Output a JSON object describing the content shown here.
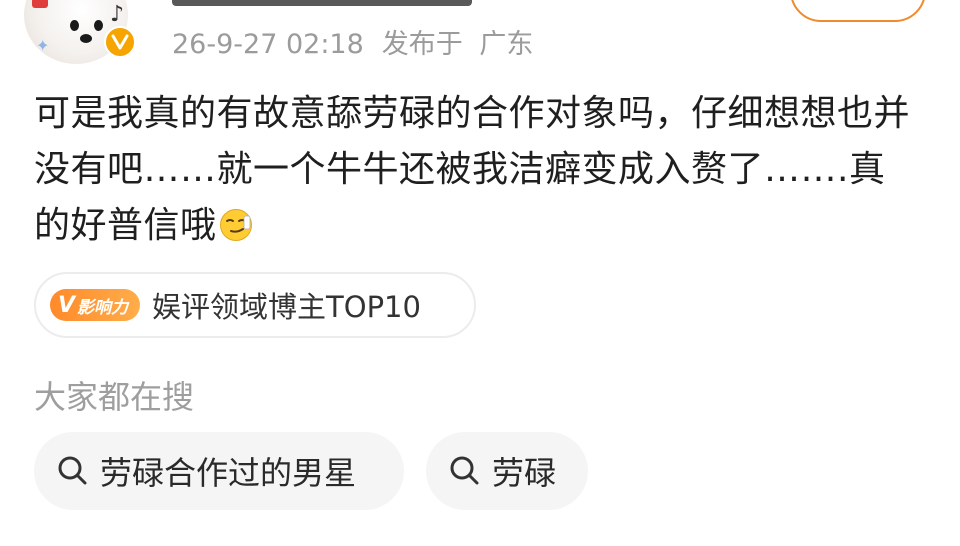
{
  "post": {
    "timestamp": "26-9-27 02:18",
    "location_prefix": "发布于",
    "location": "广东",
    "text": "可是我真的有故意舔劳碌的合作对象吗，仔细想想也并没有吧……就一个牛牛还被我洁癖变成入赘了…….真的好普信哦",
    "text_emoji": "smirk-emoji"
  },
  "influence": {
    "badge_v": "V",
    "badge_label": "影响力",
    "label": "娱评领域博主TOP10"
  },
  "search": {
    "heading": "大家都在搜",
    "chips": [
      {
        "label": "劳碌合作过的男星",
        "icon": "search-icon"
      },
      {
        "label": "劳碌",
        "icon": "search-icon"
      }
    ]
  },
  "colors": {
    "accent": "#f08a2c",
    "verified": "#f5a400",
    "meta_text": "#9b9b9b",
    "chip_bg": "#f5f5f5"
  }
}
